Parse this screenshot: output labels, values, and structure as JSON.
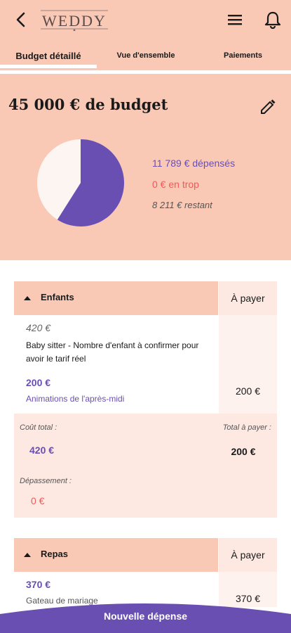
{
  "header": {
    "logo_text": "WEDDY",
    "tabs": [
      "Budget détaillé",
      "Vue d'ensemble",
      "Paiements"
    ]
  },
  "summary": {
    "title": "45 000 € de budget",
    "spent": "11 789 € dépensés",
    "over": "0 € en trop",
    "remaining": "8 211 € restant",
    "pie_spent_fraction": 0.59,
    "colors": {
      "spent": "#6a4fb3",
      "remaining": "#fdf5f2",
      "accent_bg": "#f9c9b6"
    }
  },
  "categories": [
    {
      "name": "Enfants",
      "col_label": "À payer",
      "item": {
        "planned": "420 €",
        "description": "Baby sitter - Nombre d'enfant à confirmer pour avoir le tarif réel",
        "spent": "200 €",
        "spent_label": "Animations de l'après-midi",
        "to_pay": "200 €"
      },
      "totals": {
        "cost_label": "Coût total :",
        "cost": "420 €",
        "topay_label": "Total à payer :",
        "topay": "200 €",
        "overrun_label": "Dépassement :",
        "overrun": "0 €"
      }
    },
    {
      "name": "Repas",
      "col_label": "À payer",
      "item": {
        "spent": "370 €",
        "spent_label": "Gateau de mariage",
        "to_pay": "370 €"
      }
    }
  ],
  "footer": {
    "label": "Nouvelle dépense"
  }
}
